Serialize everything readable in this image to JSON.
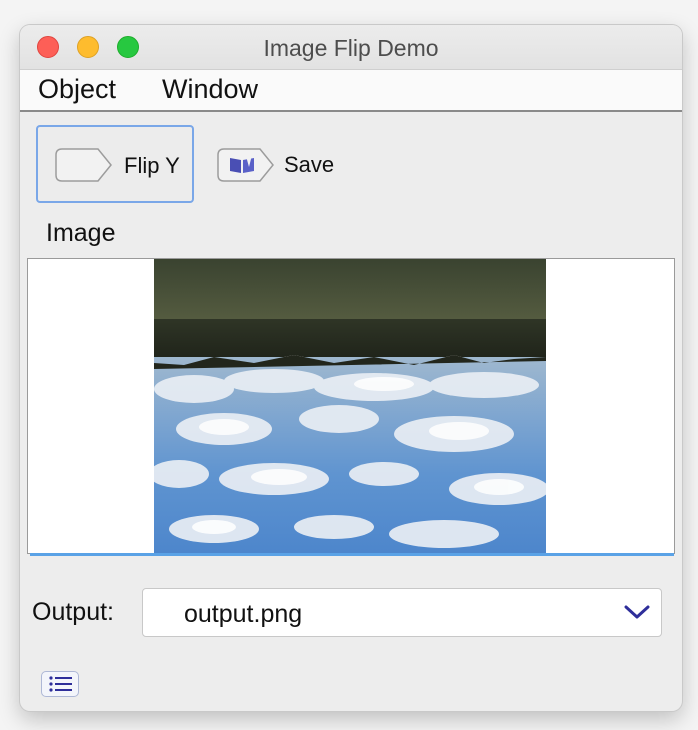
{
  "window": {
    "title": "Image Flip Demo"
  },
  "menubar": {
    "items": [
      {
        "label": "Object"
      },
      {
        "label": "Window"
      }
    ]
  },
  "toolbar": {
    "flip_label": "Flip Y",
    "save_label": "Save"
  },
  "image_section": {
    "label": "Image"
  },
  "output": {
    "label": "Output:",
    "selected": "output.png"
  },
  "icons": {
    "flip": "flip-shape-icon",
    "save": "book-icon",
    "dropdown": "chevron-down-icon",
    "list": "list-icon"
  },
  "colors": {
    "focus_ring": "#7aa7e8",
    "image_accent": "#5aa2e6",
    "chevron": "#2e2e9a",
    "close": "#fd5f57",
    "minimize": "#febc2e",
    "maximize": "#27c840"
  }
}
